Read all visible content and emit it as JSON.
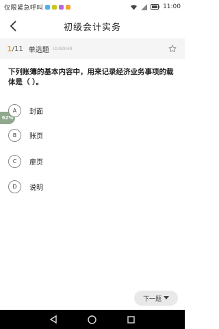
{
  "status_bar": {
    "carrier_text": "仅限紧急呼叫",
    "time": "11:00",
    "app_icon_colors": [
      "#4fb3e8",
      "#c8c820",
      "#b86ad8",
      "#f0a830"
    ]
  },
  "header": {
    "title": "初级会计实务",
    "back_icon": "chevron-left-icon"
  },
  "question_info": {
    "current": "1",
    "total": "/11",
    "type": "单选题",
    "id": "ID:90048",
    "star_icon": "star-outline-icon"
  },
  "question": {
    "text": "下列账簿的基本内容中，用来记录经济业务事项的载体是（ ）。"
  },
  "options": [
    {
      "letter": "A",
      "text": "封面"
    },
    {
      "letter": "B",
      "text": "账页"
    },
    {
      "letter": "C",
      "text": "扉页"
    },
    {
      "letter": "D",
      "text": "说明"
    }
  ],
  "float_badge": {
    "text": "52%"
  },
  "next_button": {
    "label": "下一题"
  },
  "colors": {
    "accent": "#f0a830",
    "badge": "#8fa88e",
    "nav_bar": "#000000"
  }
}
